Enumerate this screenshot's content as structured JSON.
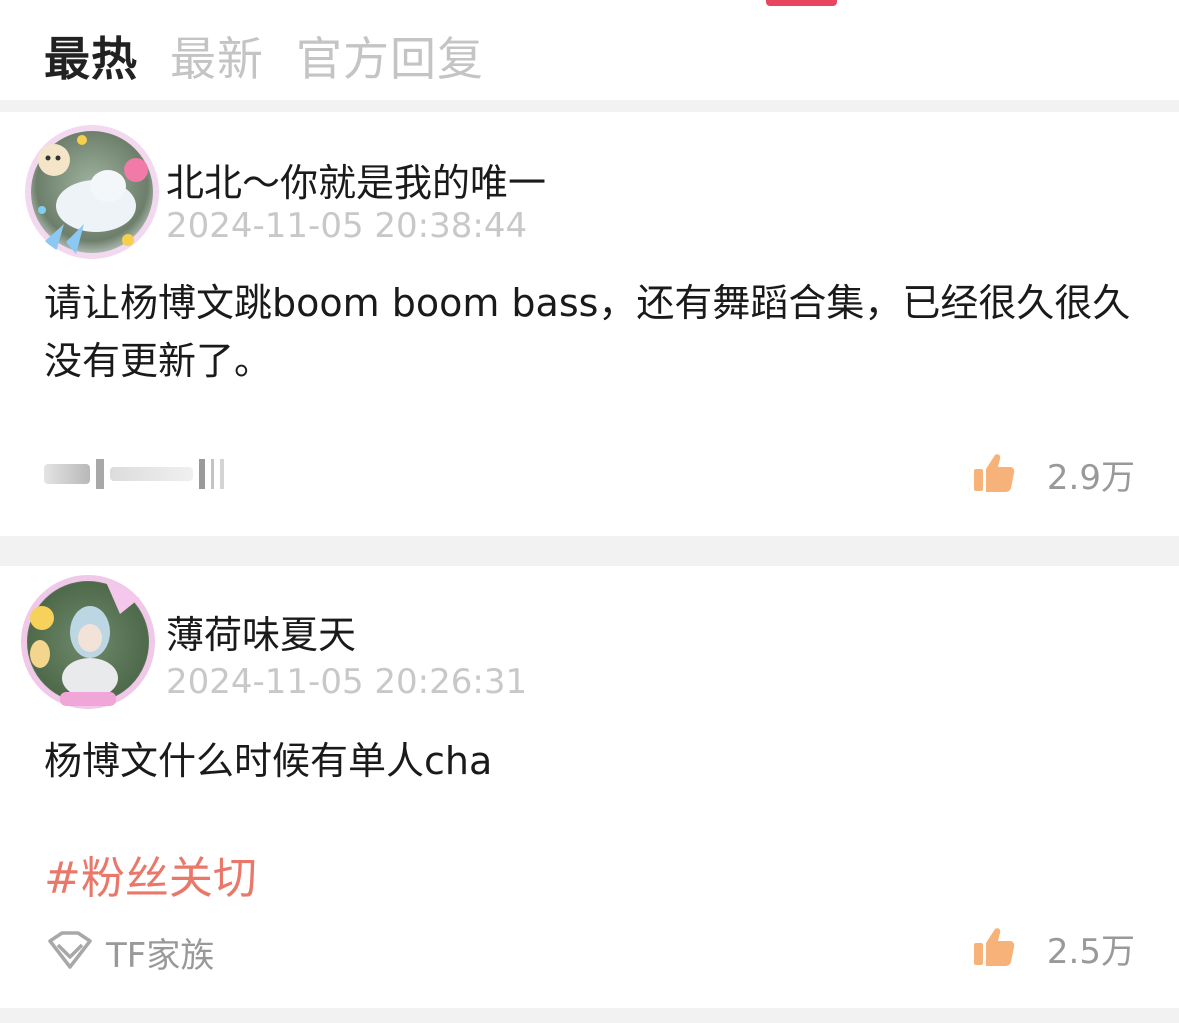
{
  "tabs": [
    {
      "label": "最热",
      "active": true
    },
    {
      "label": "最新",
      "active": false
    },
    {
      "label": "官方回复",
      "active": false
    }
  ],
  "comments": [
    {
      "username": "北北～你就是我的唯一",
      "timestamp": "2024-11-05 20:38:44",
      "text": "请让杨博文跳boom boom bass，还有舞蹈合集，已经很久很久没有更新了。",
      "likes": "2.9万"
    },
    {
      "username": "薄荷味夏天",
      "timestamp": "2024-11-05 20:26:31",
      "text": "杨博文什么时候有单人cha",
      "hashtag": "#粉丝关切",
      "source": "TF家族",
      "likes": "2.5万"
    }
  ],
  "colors": {
    "accent": "#e8455f",
    "like_icon": "#f7b27a",
    "hashtag": "#e9786b",
    "muted_text": "#999999",
    "divider": "#f2f2f2"
  },
  "icons": {
    "like": "thumbs-up-icon",
    "source": "diamond-logo-icon"
  }
}
